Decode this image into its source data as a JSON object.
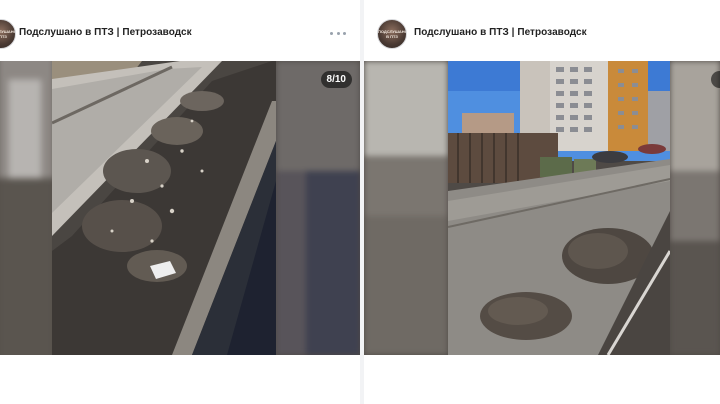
{
  "posts": [
    {
      "author": "Подслушано в ПТЗ | Петрозаводск",
      "avatar_text": "ПОДСЛУШАНО В ПТЗ",
      "counter": "8/10",
      "more_icon": "more-horizontal-icon"
    },
    {
      "author": "Подслушано в ПТЗ | Петрозаводск",
      "avatar_text": "ПОДСЛУШАНО В ПТЗ"
    }
  ],
  "colors": {
    "author_text": "#222222",
    "counter_bg": "rgba(0,0,0,0.55)",
    "divider": "#f2f3f5"
  }
}
